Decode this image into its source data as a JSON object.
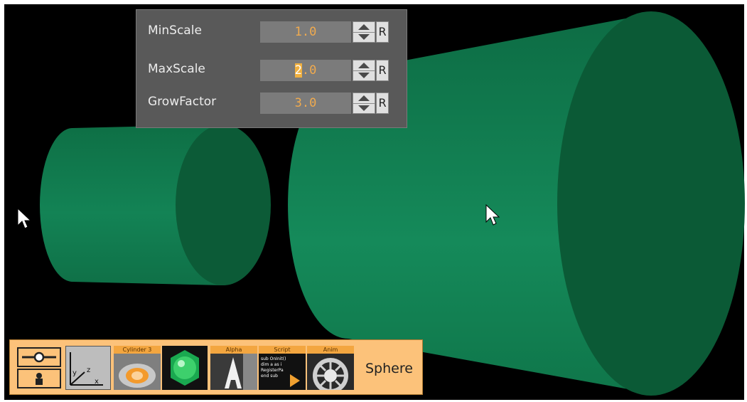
{
  "parameters": {
    "rows": [
      {
        "label": "MinScale",
        "value": "1.0",
        "reset": "R"
      },
      {
        "label": "MaxScale",
        "value": "2.0",
        "reset": "R"
      },
      {
        "label": "GrowFactor",
        "value": "3.0",
        "reset": "R"
      }
    ]
  },
  "toolbar": {
    "tiles": [
      {
        "label": "",
        "icon": "group-container-icon"
      },
      {
        "label": "",
        "icon": "transform-axes-icon",
        "axes": [
          "y",
          "z",
          "x"
        ]
      },
      {
        "label": "Cylinder 3",
        "icon": "cylinder-geometry-icon"
      },
      {
        "label": "",
        "icon": "material-sphere-icon"
      },
      {
        "label": "Alpha",
        "icon": "alpha-icon"
      },
      {
        "label": "Script",
        "icon": "script-icon",
        "lines": [
          "sub OnInit()",
          "dim a as i",
          "RegisterPa",
          "end sub"
        ]
      },
      {
        "label": "Anim",
        "icon": "anim-wheel-icon"
      }
    ],
    "container_name": "Sphere"
  },
  "colors": {
    "scene_background": "#000000",
    "cylinder_side": "#107a4e",
    "cylinder_cap": "#0c5d38",
    "panel_background": "#595959",
    "value_text": "#f0aa4e",
    "toolbar_background": "#fcc27a"
  }
}
